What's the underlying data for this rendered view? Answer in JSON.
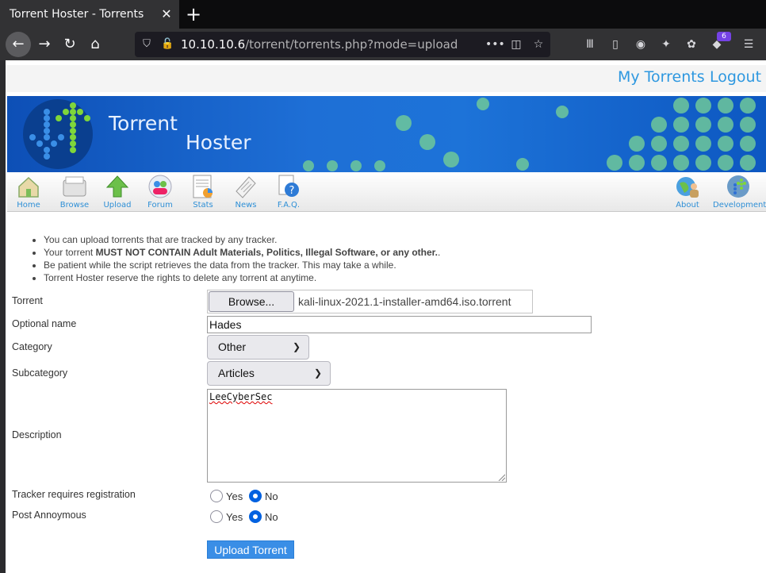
{
  "browser": {
    "tab_title": "Torrent Hoster - Torrents",
    "url_host": "10.10.10.6",
    "url_path": "/torrent/torrents.php?mode=upload",
    "badge_count": "6"
  },
  "top_links": {
    "my_torrents": "My Torrents",
    "logout": "Logout"
  },
  "banner": {
    "title_line1": "Torrent",
    "title_line2": "Hoster"
  },
  "menu": {
    "home": "Home",
    "browse": "Browse",
    "upload": "Upload",
    "forum": "Forum",
    "stats": "Stats",
    "news": "News",
    "faq": "F.A.Q.",
    "about": "About",
    "development": "Development"
  },
  "notes": {
    "line1": "You can upload torrents that are tracked by any tracker.",
    "line2_prefix": "Your torrent ",
    "line2_bold": "MUST NOT CONTAIN Adult Materials, Politics, Illegal Software, or any other.",
    "line2_suffix": ".",
    "line3": "Be patient while the script retrieves the data from the tracker. This may take a while.",
    "line4": "Torrent Hoster reserve the rights to delete any torrent at anytime."
  },
  "form": {
    "torrent_label": "Torrent",
    "browse_button": "Browse...",
    "file_name": "kali-linux-2021.1-installer-amd64.iso.torrent",
    "optional_name_label": "Optional name",
    "optional_name_value": "Hades",
    "category_label": "Category",
    "category_value": "Other",
    "subcategory_label": "Subcategory",
    "subcategory_value": "Articles",
    "description_label": "Description",
    "description_value": "LeeCyberSec",
    "tracker_reg_label": "Tracker requires registration",
    "post_anon_label": "Post Annoymous",
    "yes": "Yes",
    "no": "No",
    "submit": "Upload Torrent"
  },
  "colors": {
    "link": "#2e98e0",
    "banner": "#1e6fd6",
    "submit": "#3a8ee6",
    "radio_checked": "#0061e0"
  }
}
